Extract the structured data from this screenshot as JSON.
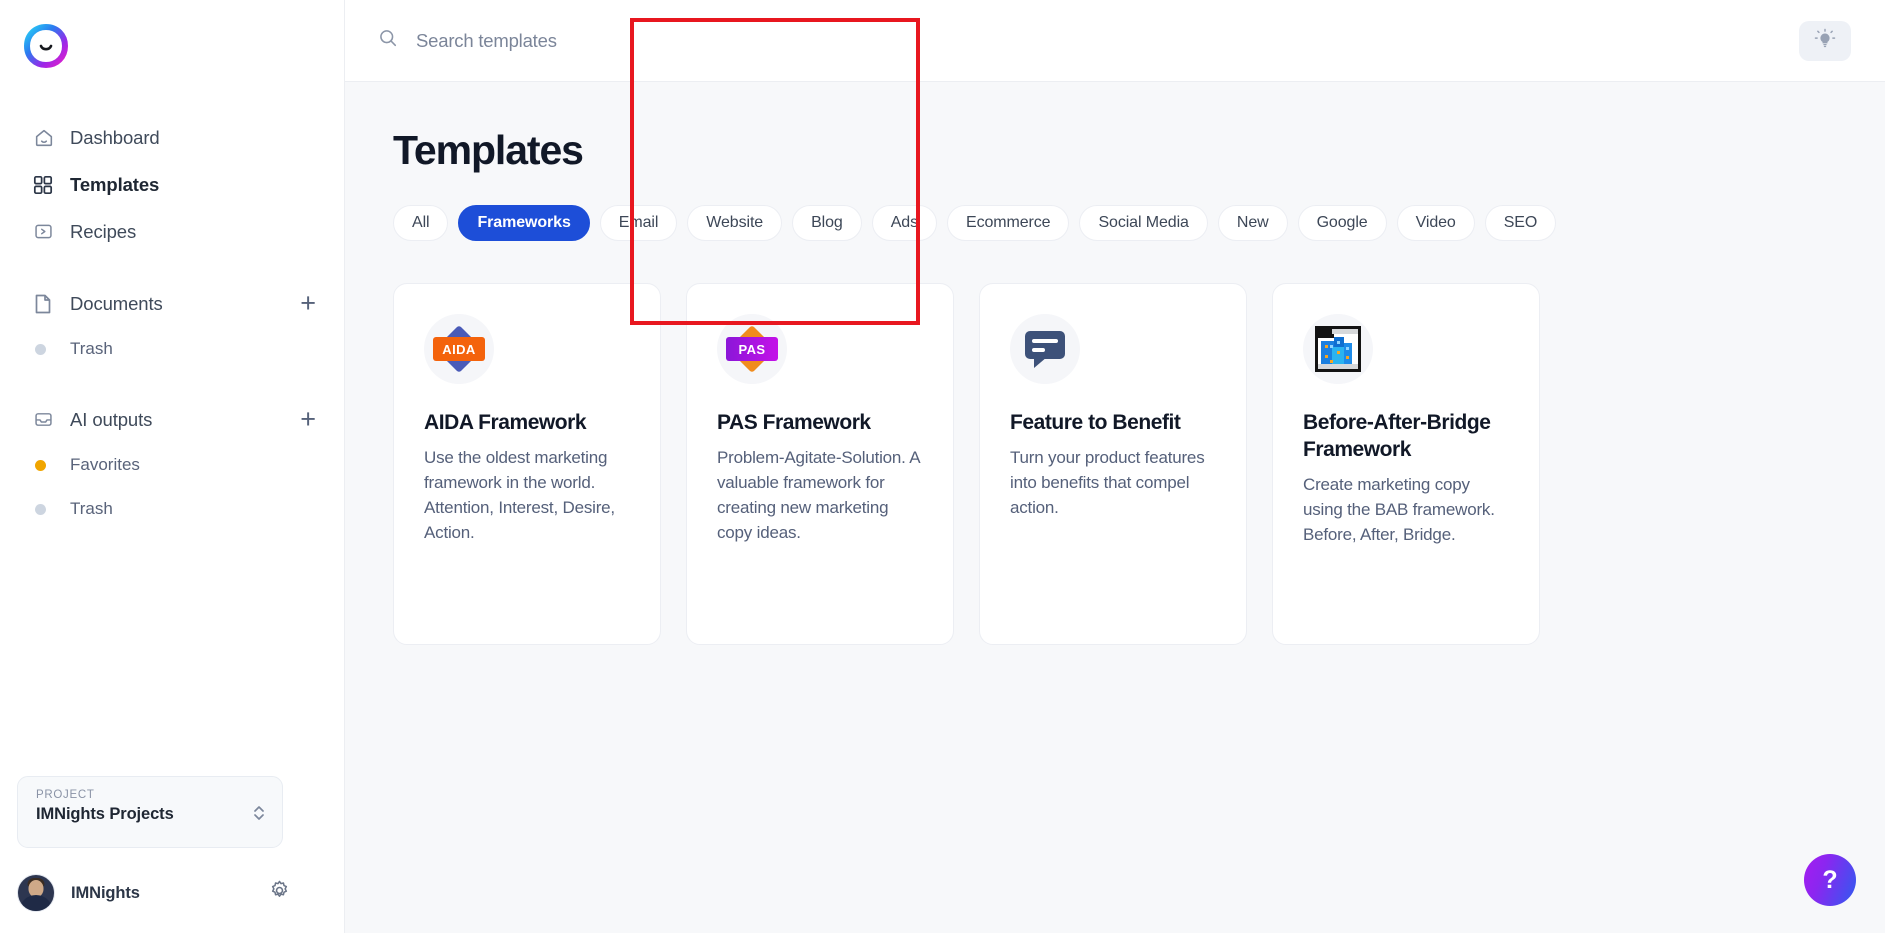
{
  "brand": {
    "logo_icon": "smiley-ring-logo"
  },
  "sidebar": {
    "nav": [
      {
        "label": "Dashboard",
        "icon": "home-icon",
        "active": false
      },
      {
        "label": "Templates",
        "icon": "grid-icon",
        "active": true
      },
      {
        "label": "Recipes",
        "icon": "terminal-icon",
        "active": false
      }
    ],
    "sections": [
      {
        "label": "Documents",
        "icon": "file-icon",
        "add_icon": "plus-icon",
        "items": [
          {
            "label": "Trash",
            "dot_color": "#cdd5e0"
          }
        ]
      },
      {
        "label": "AI outputs",
        "icon": "inbox-icon",
        "add_icon": "plus-icon",
        "items": [
          {
            "label": "Favorites",
            "dot_color": "#f0a500"
          },
          {
            "label": "Trash",
            "dot_color": "#cdd5e0"
          }
        ]
      }
    ],
    "project": {
      "label": "PROJECT",
      "name": "IMNights Projects",
      "chevron_icon": "chevron-up-down-icon"
    },
    "user": {
      "name": "IMNights",
      "avatar_icon": "user-avatar",
      "settings_icon": "gear-icon"
    }
  },
  "topbar": {
    "search": {
      "placeholder": "Search templates",
      "value": "",
      "icon": "search-icon"
    },
    "theme_toggle": {
      "icon": "lightbulb-icon"
    }
  },
  "page": {
    "title": "Templates",
    "filters": [
      {
        "label": "All",
        "active": false
      },
      {
        "label": "Frameworks",
        "active": true
      },
      {
        "label": "Email",
        "active": false
      },
      {
        "label": "Website",
        "active": false
      },
      {
        "label": "Blog",
        "active": false
      },
      {
        "label": "Ads",
        "active": false
      },
      {
        "label": "Ecommerce",
        "active": false
      },
      {
        "label": "Social Media",
        "active": false
      },
      {
        "label": "New",
        "active": false
      },
      {
        "label": "Google",
        "active": false
      },
      {
        "label": "Video",
        "active": false
      },
      {
        "label": "SEO",
        "active": false
      }
    ],
    "cards": [
      {
        "title": "AIDA Framework",
        "description": "Use the oldest marketing framework in the world. Attention, Interest, Desire, Action.",
        "icon": "aida-badge-icon",
        "badge_text": "AIDA",
        "badge_rect_color": "#f4630c",
        "badge_diamond_color": "#4a5bb8",
        "highlighted": false
      },
      {
        "title": "PAS Framework",
        "description": "Problem-Agitate-Solution. A valuable framework for creating new marketing copy ideas.",
        "icon": "pas-badge-icon",
        "badge_text": "PAS",
        "badge_rect_color": "#a21bd8",
        "badge_diamond_color": "#f08c1e",
        "highlighted": true
      },
      {
        "title": "Feature to Benefit",
        "description": "Turn your product features into benefits that compel action.",
        "icon": "speech-bubble-icon",
        "badge_text": "",
        "highlighted": false
      },
      {
        "title": "Before-After-Bridge Framework",
        "description": "Create marketing copy using the BAB framework. Before, After, Bridge.",
        "icon": "bridge-city-icon",
        "badge_text": "",
        "highlighted": false
      }
    ]
  },
  "help": {
    "label": "?",
    "icon": "question-mark-icon"
  },
  "colors": {
    "accent_blue": "#1d4ed8",
    "highlight_red": "#e8171f",
    "canvas": "#f7f8fa",
    "favorite_dot": "#f0a500"
  }
}
